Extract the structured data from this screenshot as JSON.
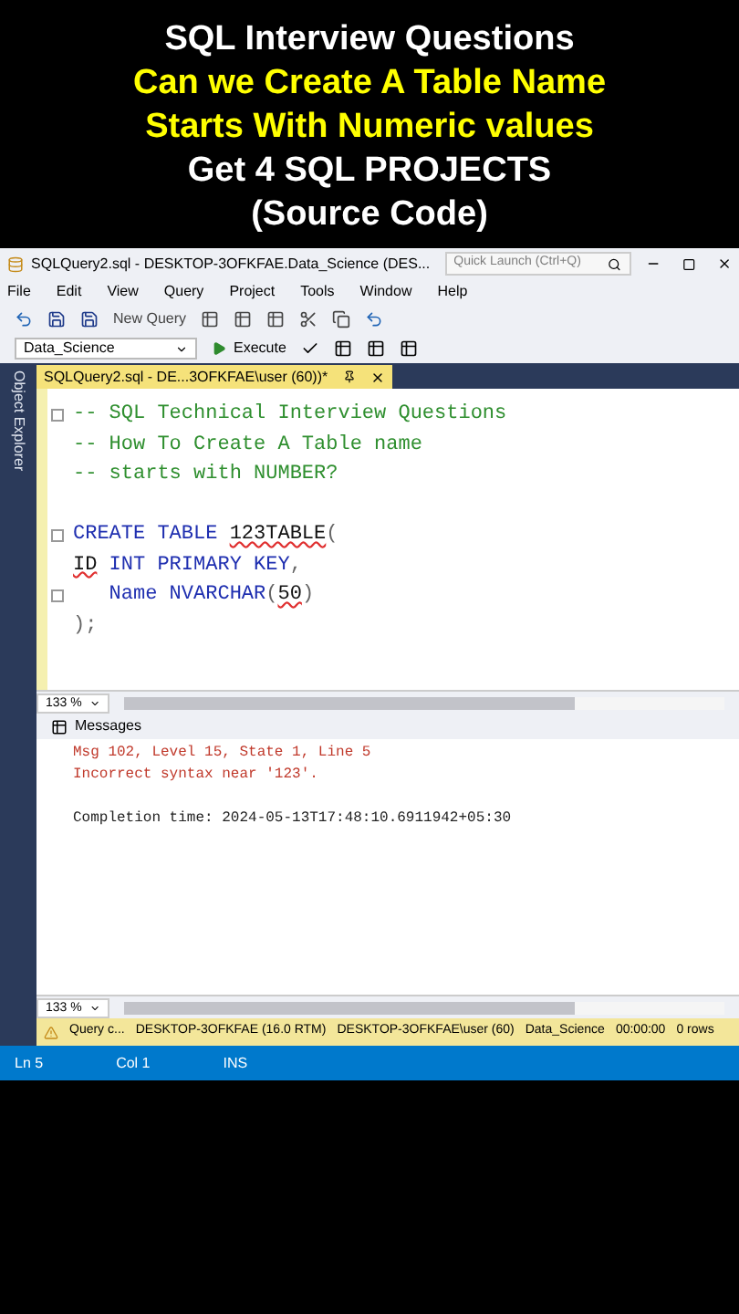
{
  "headline": [
    {
      "text": "SQL Interview Questions",
      "color": "#ffffff"
    },
    {
      "text": "Can we Create A Table Name",
      "color": "#ffff00"
    },
    {
      "text": "Starts With Numeric values",
      "color": "#ffff00"
    },
    {
      "text": "Get 4 SQL PROJECTS",
      "color": "#ffffff"
    },
    {
      "text": "(Source Code)",
      "color": "#ffffff"
    }
  ],
  "window": {
    "title": "SQLQuery2.sql - DESKTOP-3OFKFAE.Data_Science (DES...",
    "quick_launch": {
      "placeholder": "Quick Launch (Ctrl+Q)"
    }
  },
  "menu": [
    "File",
    "Edit",
    "View",
    "Query",
    "Project",
    "Tools",
    "Window",
    "Help"
  ],
  "toolbar": {
    "new_query": "New Query",
    "database": "Data_Science",
    "execute": "Execute"
  },
  "side_panel": {
    "label": "Object Explorer"
  },
  "document_tab": {
    "label": "SQLQuery2.sql - DE...3OFKFAE\\user (60))*",
    "selected": true
  },
  "editor": {
    "lines": [
      {
        "fold": true,
        "segments": [
          {
            "text": "-- SQL Technical Interview Questions",
            "kind": "comment",
            "error": false
          }
        ]
      },
      {
        "fold": false,
        "segments": [
          {
            "text": "-- How To Create A Table name",
            "kind": "comment",
            "error": false
          }
        ]
      },
      {
        "fold": false,
        "segments": [
          {
            "text": "-- starts with NUMBER?",
            "kind": "comment",
            "error": false
          }
        ]
      },
      {
        "fold": false
      },
      {
        "fold": true,
        "segments": [
          {
            "text": "CREATE TABLE ",
            "kind": "keyword",
            "error": false
          },
          {
            "text": "123TABLE",
            "kind": "plain",
            "error": true
          },
          {
            "text": "(",
            "kind": "paren",
            "error": false
          }
        ]
      },
      {
        "fold": false,
        "segments": [
          {
            "text": "ID",
            "kind": "plain",
            "error": true
          },
          {
            "text": " INT PRIMARY KEY",
            "kind": "keyword",
            "error": false
          },
          {
            "text": ",",
            "kind": "paren",
            "error": false
          }
        ]
      },
      {
        "fold": true,
        "segments": [
          {
            "text": "   Name NVARCHAR",
            "kind": "keyword",
            "error": false
          },
          {
            "text": "(",
            "kind": "paren",
            "error": false
          },
          {
            "text": "50",
            "kind": "plain",
            "error": true
          },
          {
            "text": ")",
            "kind": "paren",
            "error": false
          }
        ]
      },
      {
        "fold": false,
        "segments": [
          {
            "text": ");",
            "kind": "paren",
            "error": false
          }
        ]
      }
    ],
    "zoom": "133 %"
  },
  "messages": {
    "tab": "Messages",
    "lines": [
      {
        "text": "Msg 102, Level 15, State 1, Line 5",
        "kind": "error"
      },
      {
        "text": "Incorrect syntax near '123'.",
        "kind": "error"
      },
      {
        "kind": "blank"
      },
      {
        "text": "Completion time: 2024-05-13T17:48:10.6911942+05:30",
        "kind": "normal"
      }
    ],
    "zoom": "133 %"
  },
  "query_status": [
    "Query c...",
    "DESKTOP-3OFKFAE (16.0 RTM)",
    "DESKTOP-3OFKFAE\\user (60)",
    "Data_Science",
    "00:00:00",
    "0 rows"
  ],
  "status_bar": [
    "Ln 5",
    "Col 1",
    "INS"
  ]
}
